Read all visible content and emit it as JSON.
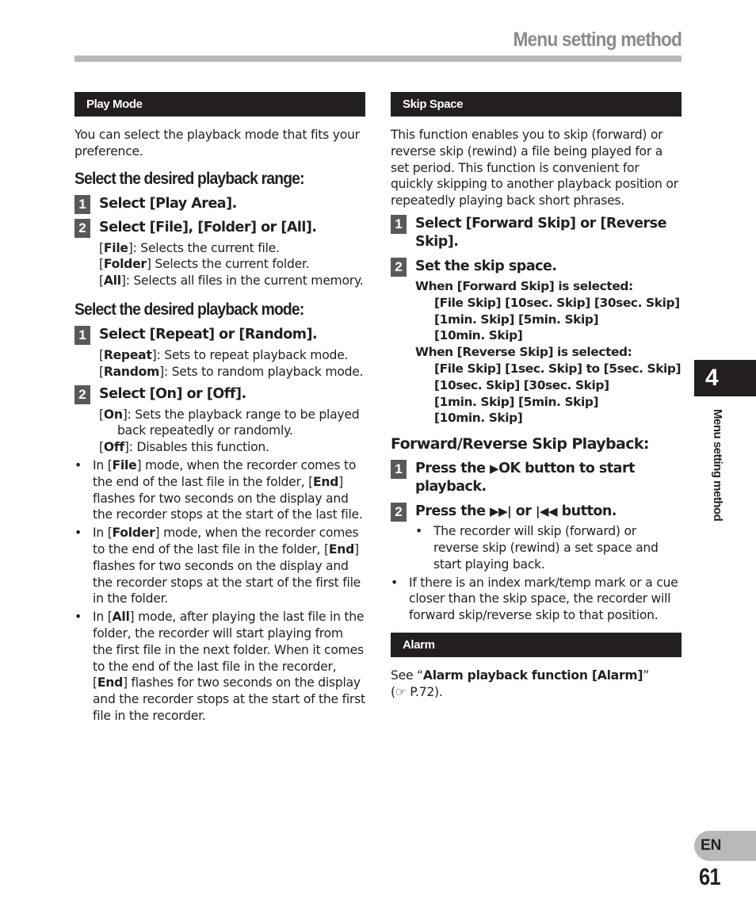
{
  "header": {
    "title": "Menu setting method"
  },
  "left": {
    "section_title": "Play Mode",
    "intro": "You can select the playback mode that fits your preference.",
    "range": {
      "heading": "Select the desired playback range:",
      "step1": {
        "num": "1",
        "pre": "Select [",
        "bold": "Play Area",
        "post": "]."
      },
      "step2": {
        "num": "2",
        "text": "Select [File], [Folder] or [All]."
      },
      "opts": [
        {
          "bold": "File",
          "rest": "]: Selects the current file."
        },
        {
          "bold": "Folder",
          "rest": "] Selects the current folder."
        },
        {
          "bold": "All",
          "rest": "]: Selects all files in the current memory."
        }
      ]
    },
    "mode": {
      "heading": "Select the desired playback mode:",
      "step1": {
        "num": "1",
        "text": "Select [Repeat] or [Random]."
      },
      "step1_opts": [
        {
          "bold": "Repeat",
          "rest": "]: Sets to repeat playback mode."
        },
        {
          "bold": "Random",
          "rest": "]: Sets to random playback mode."
        }
      ],
      "step2": {
        "num": "2",
        "text": "Select [On] or [Off]."
      },
      "step2_opts": [
        {
          "bold": "On",
          "rest": "]: Sets the playback range to be played back repeatedly or randomly."
        },
        {
          "bold": "Off",
          "rest": "]: Disables this function."
        }
      ]
    },
    "bullets": [
      {
        "pre": "In [",
        "bold": "File",
        "mid": "] mode, when the recorder comes to the end of the last file in the folder, [",
        "bold2": "End",
        "post": "] flashes for two seconds on the display and the recorder stops at the start of the last file."
      },
      {
        "pre": "In [",
        "bold": "Folder",
        "mid": "] mode, when the recorder comes to the end of the last file in the folder, [",
        "bold2": "End",
        "post": "] flashes for two seconds on the display and the recorder stops at the start of the first file in the folder."
      },
      {
        "pre": "In [",
        "bold": "All",
        "mid": "] mode, after playing the last file in the folder, the recorder will start playing from the first file in the next folder. When it comes to the end of the last file in the recorder, [",
        "bold2": "End",
        "post": "] flashes for two seconds on the display and the recorder stops at the start of the first file in the recorder."
      }
    ]
  },
  "right": {
    "section_title": "Skip Space",
    "intro": "This function enables you to skip (forward) or reverse skip (rewind) a file being played for a set period. This function is convenient for quickly skipping to another playback position or repeatedly playing back short phrases.",
    "step1": {
      "num": "1",
      "text": "Select [Forward Skip] or [Reverse Skip]."
    },
    "step2": {
      "num": "2",
      "text": "Set the skip space."
    },
    "forward": {
      "label": "When [Forward Skip] is selected:",
      "lines": [
        "[File Skip] [10sec. Skip] [30sec. Skip]",
        "[1min. Skip] [5min. Skip]",
        "[10min. Skip]"
      ]
    },
    "reverse": {
      "label": "When [Reverse Skip] is selected:",
      "lines": [
        "[File Skip] [1sec. Skip] to [5sec. Skip]",
        "[10sec. Skip] [30sec. Skip]",
        "[1min. Skip] [5min. Skip]",
        "[10min. Skip]"
      ]
    },
    "playback": {
      "heading": "Forward/Reverse Skip Playback:",
      "step1": {
        "num": "1",
        "pre": "Press the ",
        "icon": "▶",
        "post": "OK button to start playback."
      },
      "step2": {
        "num": "2",
        "pre": "Press the ",
        "icon_fwd": "▶▶|",
        "mid": " or ",
        "icon_rev": "|◀◀",
        "post": " button."
      },
      "inner_bullet": "The recorder will skip (forward) or reverse skip (rewind) a set space and start playing back.",
      "bullet": "If there is an index mark/temp mark or a cue closer than the skip space, the recorder will forward skip/reverse skip to that position."
    },
    "alarm": {
      "section_title": "Alarm",
      "pre": "See “",
      "bold": "Alarm playback function [Alarm]",
      "post": "”",
      "ref_icon": "☞",
      "ref": " P.72)."
    }
  },
  "side": {
    "chapter": "4",
    "label": "Menu setting method",
    "lang": "EN",
    "page": "61"
  }
}
